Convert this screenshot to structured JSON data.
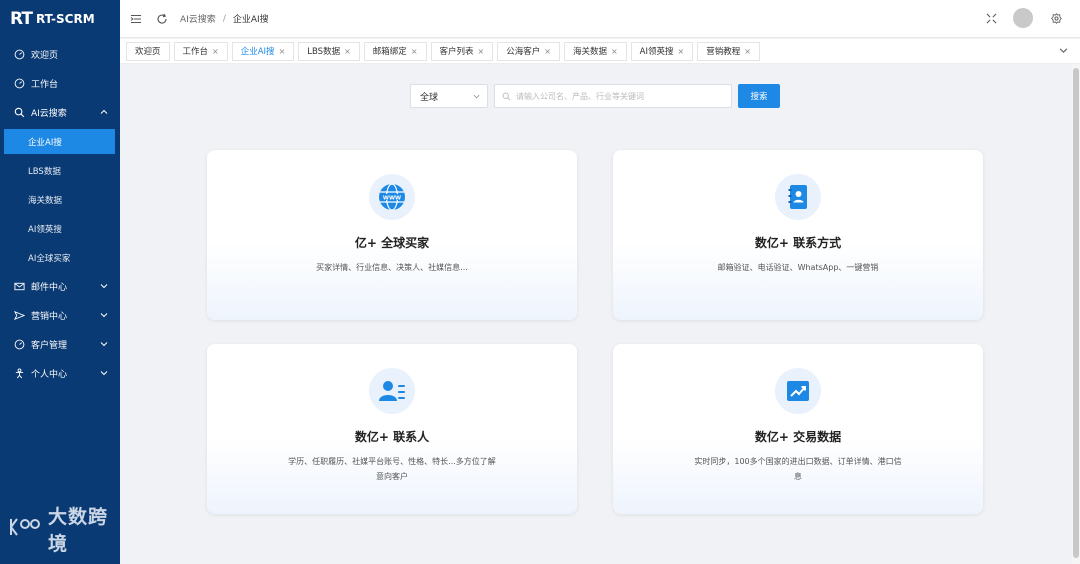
{
  "brand": {
    "logo_mark": "RT",
    "name": "RT-SCRM"
  },
  "sidebar": {
    "items": [
      {
        "label": "欢迎页",
        "icon": "dashboard-icon"
      },
      {
        "label": "工作台",
        "icon": "dashboard-icon"
      },
      {
        "label": "AI云搜索",
        "icon": "search-icon",
        "expanded": true,
        "children": [
          "企业AI搜",
          "LBS数据",
          "海关数据",
          "AI领英搜",
          "AI全球买家"
        ],
        "active_child": "企业AI搜"
      },
      {
        "label": "邮件中心",
        "icon": "mail-icon"
      },
      {
        "label": "营销中心",
        "icon": "send-icon"
      },
      {
        "label": "客户管理",
        "icon": "dashboard-icon"
      },
      {
        "label": "个人中心",
        "icon": "person-icon"
      }
    ]
  },
  "watermark": {
    "text": "大数跨境"
  },
  "header": {
    "breadcrumb": [
      "AI云搜索",
      "企业AI搜"
    ]
  },
  "tabs": [
    {
      "label": "欢迎页",
      "closable": false,
      "active": false
    },
    {
      "label": "工作台",
      "closable": true,
      "active": false
    },
    {
      "label": "企业AI搜",
      "closable": true,
      "active": true
    },
    {
      "label": "LBS数据",
      "closable": true,
      "active": false
    },
    {
      "label": "邮箱绑定",
      "closable": true,
      "active": false
    },
    {
      "label": "客户列表",
      "closable": true,
      "active": false
    },
    {
      "label": "公海客户",
      "closable": true,
      "active": false
    },
    {
      "label": "海关数据",
      "closable": true,
      "active": false
    },
    {
      "label": "AI领英搜",
      "closable": true,
      "active": false
    },
    {
      "label": "营销教程",
      "closable": true,
      "active": false
    }
  ],
  "search": {
    "scope_value": "全球",
    "placeholder": "请输入公司名、产品、行业等关键词",
    "button_label": "搜索"
  },
  "cards": [
    {
      "title": "亿+ 全球买家",
      "desc": "买家详情、行业信息、决策人、社媒信息...",
      "icon": "globe-www-icon"
    },
    {
      "title": "数亿+ 联系方式",
      "desc": "邮箱验证、电话验证、WhatsApp、一键营销",
      "icon": "contact-book-icon"
    },
    {
      "title": "数亿+ 联系人",
      "desc": "学历、任职履历、社媒平台账号、性格、特长...多方位了解意向客户",
      "icon": "person-card-icon"
    },
    {
      "title": "数亿+ 交易数据",
      "desc": "实时同步，100多个国家的进出口数据、订单详情、港口信息",
      "icon": "trend-chart-icon"
    }
  ],
  "colors": {
    "sidebar_bg": "#0a3a73",
    "accent": "#1e88e5",
    "page_bg": "#f0f2f5"
  }
}
